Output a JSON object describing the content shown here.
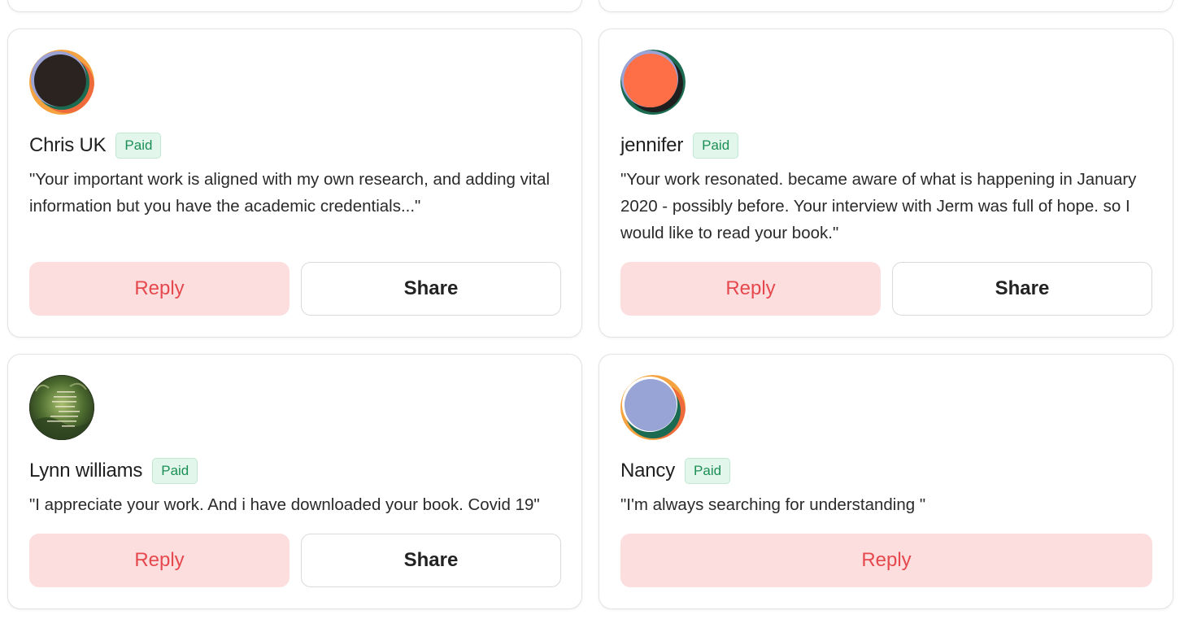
{
  "cards": [
    {
      "name": "Chris UK",
      "badge": "Paid",
      "quote": "\"Your important work is aligned with my own research, and adding vital information but you have the academic credentials...\"",
      "reply_label": "Reply",
      "share_label": "Share",
      "avatar": {
        "style": "gradient-circle",
        "main": "#2a2320",
        "back": "#f4a340",
        "accent": "#ef6b3b",
        "rim": "#9aa2d6"
      }
    },
    {
      "name": "jennifer",
      "badge": "Paid",
      "quote": "\"Your work resonated. became aware of what is happening in January 2020 - possibly before. Your interview with Jerm was full of hope. so I would like to read your book.\"",
      "reply_label": "Reply",
      "share_label": "Share",
      "avatar": {
        "style": "gradient-circle",
        "main": "#ff6f47",
        "back": "#1b6b52",
        "accent": "#1f1f1f",
        "rim": "#9aa2d6"
      }
    },
    {
      "name": "Lynn williams",
      "badge": "Paid",
      "quote": "\"I appreciate your work. And i have downloaded your book. Covid 19\"",
      "reply_label": "Reply",
      "share_label": "Share",
      "avatar": {
        "style": "photo-forest",
        "main": "#3d5a2a",
        "back": "#8aa55a",
        "accent": "#e8e2c8",
        "rim": "#2b3a1f"
      }
    },
    {
      "name": "Nancy",
      "badge": "Paid",
      "quote": "\"I'm always searching for understanding \"",
      "reply_label": "Reply",
      "avatar": {
        "style": "gradient-circle",
        "main": "#98a3d6",
        "back": "#1b6b52",
        "accent": "#ef6b3b",
        "rim": "#f4a340"
      }
    }
  ],
  "colors": {
    "reply_bg": "#fddede",
    "reply_text": "#e5484d",
    "badge_bg": "#e3f6ec",
    "badge_text": "#1b8f56"
  }
}
